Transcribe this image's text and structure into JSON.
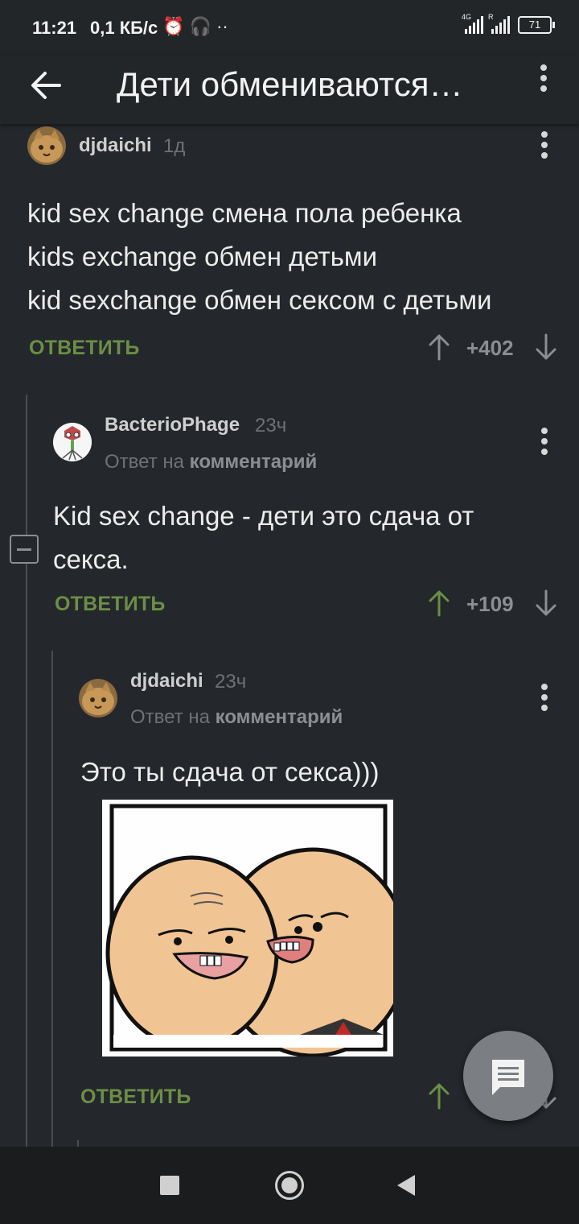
{
  "status_bar": {
    "time": "11:21",
    "net_speed": "0,1 КБ/с",
    "icons": [
      "alarm-icon",
      "headphones-icon",
      "notification-dots-icon"
    ],
    "signal1_tag": "4G",
    "signal2_tag": "R",
    "battery": "71"
  },
  "app_bar": {
    "title": "Дети обмениваются…"
  },
  "comments": [
    {
      "author": "djdaichi",
      "time": "1д",
      "lines": [
        "kid sex change смена пола ребенка",
        "kids exchange обмен детьми",
        "kid sexchange обмен сексом с детьми"
      ],
      "reply_label": "ОТВЕТИТЬ",
      "score": "+402"
    },
    {
      "author": "BacterioPhage",
      "time": "23ч",
      "reply_prefix": "Ответ на",
      "reply_target": "комментарий",
      "lines": [
        "Kid sex change - дети это сдача от",
        "секса."
      ],
      "reply_label": "ОТВЕТИТЬ",
      "score": "+109"
    },
    {
      "author": "djdaichi",
      "time": "23ч",
      "reply_prefix": "Ответ на",
      "reply_target": "комментарий",
      "lines": [
        "Это ты сдача от секса)))"
      ],
      "reply_label": "ОТВЕТИТЬ"
    }
  ],
  "colors": {
    "background": "#24272b",
    "accent_green": "#6b8f45",
    "muted": "#6e7276"
  }
}
